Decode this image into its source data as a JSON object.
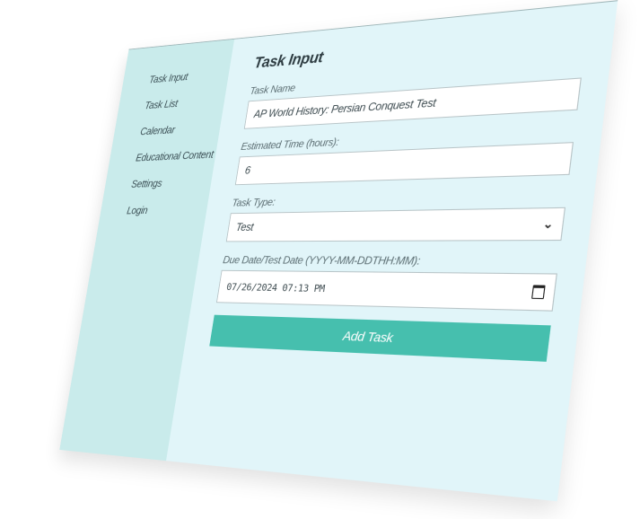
{
  "sidebar": {
    "items": [
      {
        "label": "Task Input"
      },
      {
        "label": "Task List"
      },
      {
        "label": "Calendar"
      },
      {
        "label": "Educational Content"
      },
      {
        "label": "Settings"
      },
      {
        "label": "Login"
      }
    ]
  },
  "main": {
    "title": "Task Input",
    "task_name": {
      "label": "Task Name",
      "value": "AP World History: Persian Conquest Test"
    },
    "estimated_time": {
      "label": "Estimated Time (hours):",
      "value": "6"
    },
    "task_type": {
      "label": "Task Type:",
      "selected": "Test"
    },
    "due_date": {
      "label": "Due Date/Test Date (YYYY-MM-DDTHH:MM):",
      "value": "07/26/2024 07:13 PM"
    },
    "add_button_label": "Add Task"
  },
  "icons": {
    "dropdown": "chevron-down-icon",
    "date_picker": "calendar-icon"
  },
  "colors": {
    "sidebar_bg": "#c9ebeb",
    "main_bg": "#e1f5f9",
    "accent": "#46bfae"
  }
}
